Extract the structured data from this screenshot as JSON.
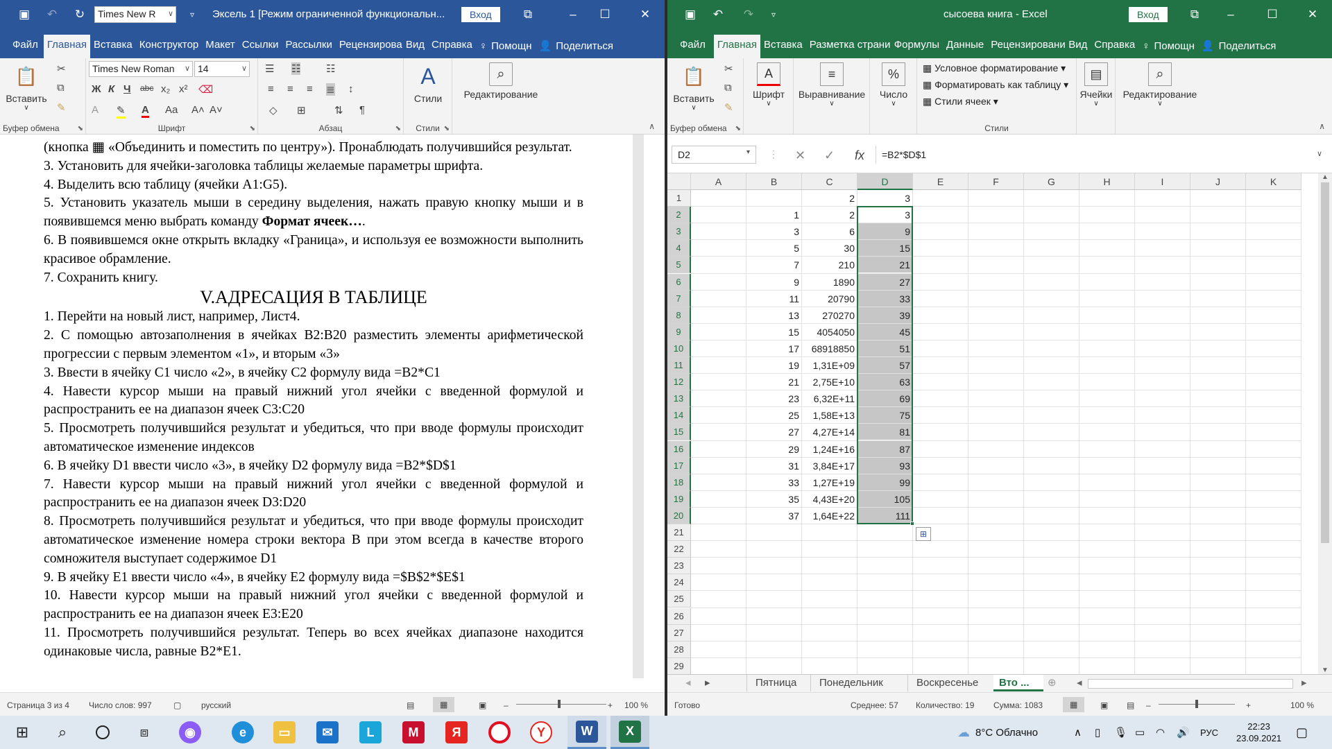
{
  "word": {
    "title": "Эксель 1 [Режим ограниченной функциональн...",
    "login_label": "Вход",
    "tabs": [
      "Файл",
      "Главная",
      "Вставка",
      "Конструктор",
      "Макет",
      "Ссылки",
      "Рассылки",
      "Рецензирова",
      "Вид",
      "Справка",
      "Помощн",
      "Поделиться"
    ],
    "active_tab": "Главная",
    "ribbon": {
      "paste_label": "Вставить",
      "clipboard_group": "Буфер обмена",
      "font_name": "Times New Roman",
      "font_size": "14",
      "font_group": "Шрифт",
      "para_group": "Абзац",
      "styles_label": "Стили",
      "styles_group": "Стили",
      "editing_label": "Редактирование",
      "quick_font": "Times New R"
    },
    "paragraphs": [
      {
        "text": "(кнопка ▦ «Объединить и поместить по центру»). Пронаблюдать получившийся результат."
      },
      {
        "text": "3. Установить для ячейки-заголовка таблицы желаемые параметры шрифта."
      },
      {
        "text": "4. Выделить всю таблицу (ячейки A1:G5)."
      },
      {
        "text": "5. Установить указатель мыши в середину выделения, нажать правую кнопку мыши и в появившемся меню выбрать команду ",
        "bold": "Формат ячеек…",
        "tail": "."
      },
      {
        "text": "6. В появившемся окне открыть вкладку «Граница», и используя ее возможности выполнить красивое обрамление."
      },
      {
        "text": "7. Сохранить книгу."
      }
    ],
    "heading": "V.АДРЕСАЦИЯ В ТАБЛИЦЕ",
    "paragraphs2": [
      "1. Перейти на новый лист, например, Лист4.",
      "2. С помощью автозаполнения в ячейках B2:B20 разместить элементы арифметической прогрессии с первым элементом «1», и вторым «3»",
      "3. Ввести в ячейку C1 число «2», в ячейку C2 формулу вида =B2*C1",
      "4. Навести курсор мыши на правый нижний угол ячейки с введенной формулой и распространить ее на диапазон ячеек C3:C20",
      "5. Просмотреть получившийся результат и убедиться, что при вводе формулы происходит автоматическое изменение индексов",
      "6. В ячейку D1 ввести число «3», в ячейку D2 формулу вида  =B2*$D$1",
      "7. Навести курсор мыши на правый нижний угол ячейки с введенной формулой и распространить ее на диапазон ячеек D3:D20",
      "8. Просмотреть получившийся результат и убедиться, что при вводе формулы происходит автоматическое изменение номера строки вектора B при этом всегда в качестве второго сомножителя выступает содержимое D1",
      "9. В ячейку E1 ввести число «4», в ячейку E2 формулу вида  =$B$2*$E$1",
      "10.  Навести курсор мыши на правый нижний угол ячейки с введенной формулой и распространить ее на диапазон ячеек E3:E20",
      "11.  Просмотреть получившийся результат. Теперь во всех ячейках диапазоне находится одинаковые числа, равные B2*E1."
    ],
    "status": {
      "page": "Страница 3 из 4",
      "words": "Число слов: 997",
      "lang": "русский",
      "zoom": "100 %"
    }
  },
  "excel": {
    "title": "сысоева книга  -  Excel",
    "login_label": "Вход",
    "tabs": [
      "Файл",
      "Главная",
      "Вставка",
      "Разметка страни",
      "Формулы",
      "Данные",
      "Рецензировани",
      "Вид",
      "Справка",
      "Помощн",
      "Поделиться"
    ],
    "active_tab": "Главная",
    "ribbon": {
      "paste_label": "Вставить",
      "clipboard_group": "Буфер обмена",
      "font_label": "Шрифт",
      "align_label": "Выравнивание",
      "number_label": "Число",
      "cond_format": "Условное форматирование",
      "format_table": "Форматировать как таблицу",
      "cell_styles": "Стили ячеек",
      "styles_group": "Стили",
      "cells_label": "Ячейки",
      "editing_label": "Редактирование"
    },
    "name_box": "D2",
    "formula": "=B2*$D$1",
    "columns": [
      "A",
      "B",
      "C",
      "D",
      "E",
      "F",
      "G",
      "H",
      "I",
      "J",
      "K"
    ],
    "rows": [
      {
        "r": "1",
        "b": "",
        "c": "2",
        "d": "3"
      },
      {
        "r": "2",
        "b": "1",
        "c": "2",
        "d": "3"
      },
      {
        "r": "3",
        "b": "3",
        "c": "6",
        "d": "9"
      },
      {
        "r": "4",
        "b": "5",
        "c": "30",
        "d": "15"
      },
      {
        "r": "5",
        "b": "7",
        "c": "210",
        "d": "21"
      },
      {
        "r": "6",
        "b": "9",
        "c": "1890",
        "d": "27"
      },
      {
        "r": "7",
        "b": "11",
        "c": "20790",
        "d": "33"
      },
      {
        "r": "8",
        "b": "13",
        "c": "270270",
        "d": "39"
      },
      {
        "r": "9",
        "b": "15",
        "c": "4054050",
        "d": "45"
      },
      {
        "r": "10",
        "b": "17",
        "c": "68918850",
        "d": "51"
      },
      {
        "r": "11",
        "b": "19",
        "c": "1,31E+09",
        "d": "57"
      },
      {
        "r": "12",
        "b": "21",
        "c": "2,75E+10",
        "d": "63"
      },
      {
        "r": "13",
        "b": "23",
        "c": "6,32E+11",
        "d": "69"
      },
      {
        "r": "14",
        "b": "25",
        "c": "1,58E+13",
        "d": "75"
      },
      {
        "r": "15",
        "b": "27",
        "c": "4,27E+14",
        "d": "81"
      },
      {
        "r": "16",
        "b": "29",
        "c": "1,24E+16",
        "d": "87"
      },
      {
        "r": "17",
        "b": "31",
        "c": "3,84E+17",
        "d": "93"
      },
      {
        "r": "18",
        "b": "33",
        "c": "1,27E+19",
        "d": "99"
      },
      {
        "r": "19",
        "b": "35",
        "c": "4,43E+20",
        "d": "105"
      },
      {
        "r": "20",
        "b": "37",
        "c": "1,64E+22",
        "d": "111"
      },
      {
        "r": "21",
        "b": "",
        "c": "",
        "d": ""
      },
      {
        "r": "22",
        "b": "",
        "c": "",
        "d": ""
      },
      {
        "r": "23",
        "b": "",
        "c": "",
        "d": ""
      },
      {
        "r": "24",
        "b": "",
        "c": "",
        "d": ""
      },
      {
        "r": "25",
        "b": "",
        "c": "",
        "d": ""
      },
      {
        "r": "26",
        "b": "",
        "c": "",
        "d": ""
      },
      {
        "r": "27",
        "b": "",
        "c": "",
        "d": ""
      },
      {
        "r": "28",
        "b": "",
        "c": "",
        "d": ""
      },
      {
        "r": "29",
        "b": "",
        "c": "",
        "d": ""
      }
    ],
    "sheets": [
      "Пятница",
      "Понедельник",
      "Воскресенье",
      "Вто ..."
    ],
    "active_sheet": "Вто ...",
    "status": {
      "ready": "Готово",
      "avg": "Среднее: 57",
      "count": "Количество: 19",
      "sum": "Сумма: 1083",
      "zoom": "100 %"
    }
  },
  "taskbar": {
    "weather": "8°C  Облачно",
    "lang": "РУС",
    "time": "22:23",
    "date": "23.09.2021"
  },
  "colors": {
    "word_blue": "#2b579a",
    "excel_green": "#217346",
    "selection_gray": "#c6c6c6"
  }
}
